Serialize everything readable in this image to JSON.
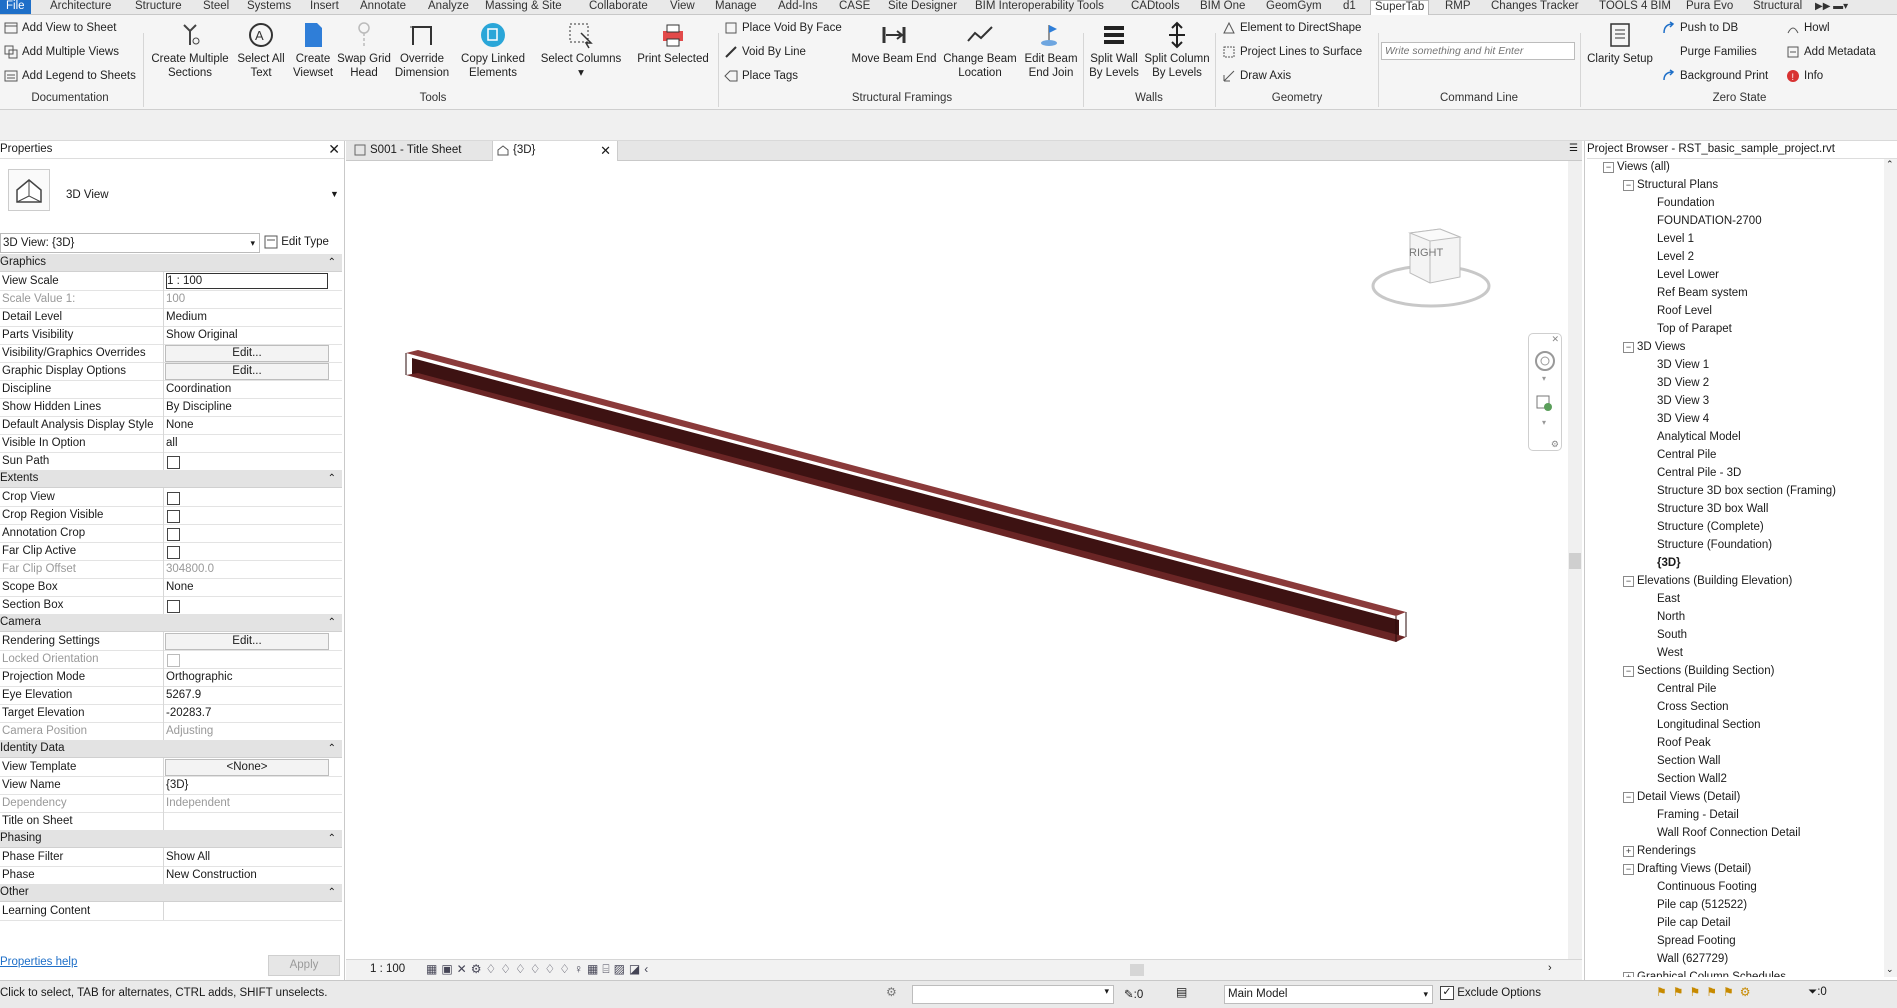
{
  "menu": {
    "tabs": [
      "File",
      "Architecture",
      "Structure",
      "Steel",
      "Systems",
      "Insert",
      "Annotate",
      "Analyze",
      "Massing & Site",
      "Collaborate",
      "View",
      "Manage",
      "Add-Ins",
      "CASE",
      "Site Designer",
      "BIM Interoperability Tools",
      "CADtools",
      "BIM One",
      "GeomGym",
      "d1",
      "SuperTab",
      "RMP",
      "Changes Tracker",
      "TOOLS 4 BIM",
      "Pura Evo",
      "Structural"
    ],
    "active": "SuperTab"
  },
  "ribbon": {
    "documentation": {
      "label": "Documentation",
      "items": [
        "Add View to Sheet",
        "Add Multiple Views",
        "Add Legend to Sheets"
      ]
    },
    "tools": {
      "label": "Tools",
      "buttons": [
        {
          "l1": "Create Multiple",
          "l2": "Sections"
        },
        {
          "l1": "Select All",
          "l2": "Text"
        },
        {
          "l1": "Create",
          "l2": "Viewset"
        },
        {
          "l1": "Swap Grid",
          "l2": "Head"
        },
        {
          "l1": "Override",
          "l2": "Dimension"
        },
        {
          "l1": "Copy Linked",
          "l2": "Elements"
        },
        {
          "l1": "Select Columns",
          "l2": ""
        },
        {
          "l1": "Print Selected",
          "l2": ""
        }
      ]
    },
    "structural": {
      "label": "Structural Framings",
      "small": [
        "Place Void  By Face",
        "Void By Line",
        "Place Tags"
      ],
      "buttons": [
        {
          "l1": "Move Beam End",
          "l2": ""
        },
        {
          "l1": "Change Beam",
          "l2": "Location"
        },
        {
          "l1": "Edit Beam",
          "l2": "End Join"
        }
      ]
    },
    "walls": {
      "label": "Walls",
      "buttons": [
        {
          "l1": "Split Wall",
          "l2": "By Levels"
        },
        {
          "l1": "Split Column",
          "l2": "By Levels"
        }
      ]
    },
    "geometry": {
      "label": "Geometry",
      "small": [
        "Element to DirectShape",
        "Project Lines to Surface",
        "Draw Axis"
      ]
    },
    "command": {
      "label": "Command Line",
      "placeholder": "Write something and hit Enter"
    },
    "zero": {
      "label": "Zero State",
      "clarity": "Clarity Setup",
      "col1": [
        "Push to DB",
        "Purge Families",
        "Background  Print"
      ],
      "col2": [
        "Howl",
        "Add Metadata",
        "Info"
      ]
    }
  },
  "properties": {
    "title": "Properties",
    "type_name": "3D View",
    "selector": "3D View: {3D}",
    "edit_type": "Edit Type",
    "sections": {
      "graphics": "Graphics",
      "extents": "Extents",
      "camera": "Camera",
      "identity": "Identity Data",
      "phasing": "Phasing",
      "other": "Other"
    },
    "rows": {
      "view_scale": [
        "View Scale",
        "1 : 100"
      ],
      "scale_value": [
        "Scale Value    1:",
        "100"
      ],
      "detail_level": [
        "Detail Level",
        "Medium"
      ],
      "parts_visibility": [
        "Parts Visibility",
        "Show Original"
      ],
      "vg_overrides": [
        "Visibility/Graphics Overrides",
        "Edit..."
      ],
      "graphic_display": [
        "Graphic Display Options",
        "Edit..."
      ],
      "discipline": [
        "Discipline",
        "Coordination"
      ],
      "hidden_lines": [
        "Show Hidden Lines",
        "By Discipline"
      ],
      "analysis_style": [
        "Default Analysis Display Style",
        "None"
      ],
      "visible_in": [
        "Visible In Option",
        "all"
      ],
      "sun_path": [
        "Sun Path",
        ""
      ],
      "crop_view": [
        "Crop View",
        ""
      ],
      "crop_region": [
        "Crop Region Visible",
        ""
      ],
      "annotation_crop": [
        "Annotation Crop",
        ""
      ],
      "far_clip_active": [
        "Far Clip Active",
        ""
      ],
      "far_clip_offset": [
        "Far Clip Offset",
        "304800.0"
      ],
      "scope_box": [
        "Scope Box",
        "None"
      ],
      "section_box": [
        "Section Box",
        ""
      ],
      "rendering": [
        "Rendering Settings",
        "Edit..."
      ],
      "locked_orientation": [
        "Locked Orientation",
        ""
      ],
      "projection_mode": [
        "Projection Mode",
        "Orthographic"
      ],
      "eye_elevation": [
        "Eye Elevation",
        "5267.9"
      ],
      "target_elevation": [
        "Target Elevation",
        "-20283.7"
      ],
      "camera_position": [
        "Camera Position",
        "Adjusting"
      ],
      "view_template": [
        "View Template",
        "<None>"
      ],
      "view_name": [
        "View Name",
        "{3D}"
      ],
      "dependency": [
        "Dependency",
        "Independent"
      ],
      "title_on_sheet": [
        "Title on Sheet",
        ""
      ],
      "phase_filter": [
        "Phase Filter",
        "Show All"
      ],
      "phase": [
        "Phase",
        "New Construction"
      ],
      "learning": [
        "Learning Content",
        ""
      ]
    },
    "help": "Properties help",
    "apply": "Apply"
  },
  "view_tabs": [
    {
      "label": "S001 - Title Sheet",
      "active": false
    },
    {
      "label": "{3D}",
      "active": true
    }
  ],
  "viewcube_label": "RIGHT",
  "viewbar": {
    "scale": "1 : 100"
  },
  "browser": {
    "title": "Project Browser - RST_basic_sample_project.rvt",
    "root": "Views (all)",
    "groups": [
      {
        "name": "Structural Plans",
        "items": [
          "Foundation",
          "FOUNDATION-2700",
          "Level 1",
          "Level 2",
          "Level Lower",
          "Ref Beam system",
          "Roof Level",
          "Top of Parapet"
        ]
      },
      {
        "name": "3D Views",
        "items": [
          "3D View 1",
          "3D View 2",
          "3D View 3",
          "3D View 4",
          "Analytical Model",
          "Central Pile",
          "Central Pile - 3D",
          "Structure 3D box section (Framing)",
          "Structure 3D box Wall",
          "Structure (Complete)",
          "Structure (Foundation)",
          "{3D}"
        ]
      },
      {
        "name": "Elevations (Building Elevation)",
        "items": [
          "East",
          "North",
          "South",
          "West"
        ]
      },
      {
        "name": "Sections (Building Section)",
        "items": [
          "Central Pile",
          "Cross Section",
          "Longitudinal Section",
          "Roof Peak",
          "Section Wall",
          "Section Wall2"
        ]
      },
      {
        "name": "Detail Views (Detail)",
        "items": [
          "Framing - Detail",
          "Wall Roof Connection Detail"
        ]
      },
      {
        "name": "Renderings",
        "items": []
      },
      {
        "name": "Drafting Views (Detail)",
        "items": [
          "Continuous Footing",
          "Pile cap (512522)",
          "Pile cap Detail",
          "Spread Footing",
          "Wall (627729)"
        ]
      },
      {
        "name": "Graphical Column Schedules",
        "items": []
      }
    ]
  },
  "status": {
    "hint": "Click to select, TAB for alternates, CTRL adds, SHIFT unselects.",
    "zero": ":0",
    "model": "Main Model",
    "exclude": "Exclude Options",
    "filter_count": ":0"
  },
  "colors": {
    "beam": "#5a1c1c",
    "beam_top": "#8a3a3a",
    "accent": "#1e6fc8"
  }
}
